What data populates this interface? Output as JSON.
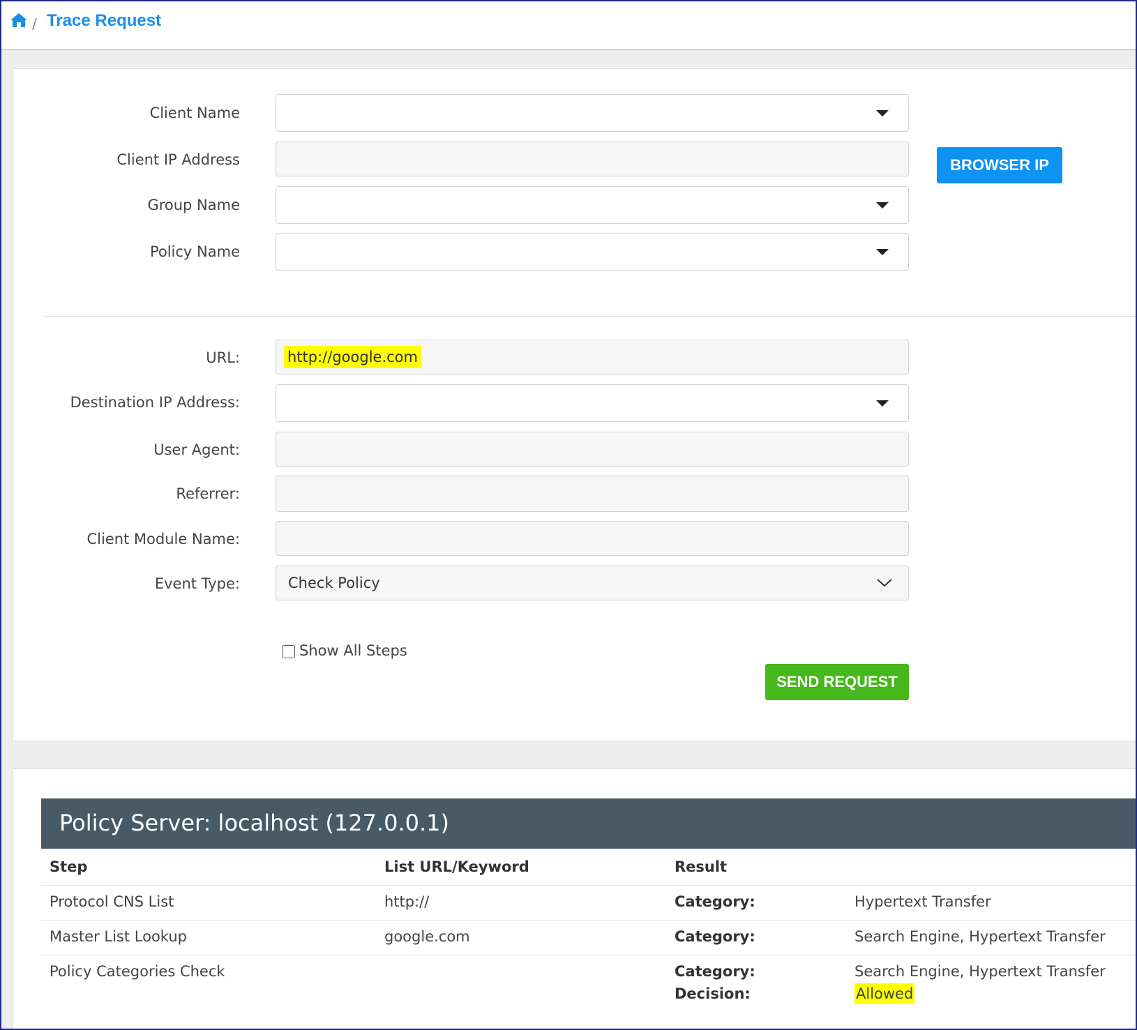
{
  "breadcrumb": {
    "home_icon": "home-icon",
    "separator": "/",
    "title": "Trace Request"
  },
  "form": {
    "client_name_label": "Client Name",
    "client_ip_label": "Client IP Address",
    "group_name_label": "Group Name",
    "policy_name_label": "Policy Name",
    "browser_ip_button": "BROWSER IP",
    "url_label": "URL:",
    "url_value": "http://google.com",
    "dest_ip_label": "Destination IP Address:",
    "user_agent_label": "User Agent:",
    "referrer_label": "Referrer:",
    "client_module_label": "Client Module Name:",
    "event_type_label": "Event Type:",
    "event_type_value": "Check Policy",
    "show_all_steps_label": "Show All Steps",
    "send_request_button": "SEND REQUEST"
  },
  "results": {
    "server_title": "Policy Server: localhost (127.0.0.1)",
    "headers": {
      "step": "Step",
      "list": "List URL/Keyword",
      "result": "Result"
    },
    "rows": [
      {
        "step": "Protocol CNS List",
        "list": "http://",
        "key": "Category:",
        "value": "Hypertext Transfer"
      },
      {
        "step": "Master List Lookup",
        "list": "google.com",
        "key": "Category:",
        "value": "Search Engine, Hypertext Transfer"
      },
      {
        "step": "Policy Categories Check",
        "list": "",
        "key": "Category:",
        "value": "Search Engine, Hypertext Transfer",
        "key2": "Decision:",
        "value2": "Allowed"
      }
    ]
  },
  "colors": {
    "accent_blue": "#0d93f3",
    "send_green": "#47b81c",
    "header_slate": "#475a66",
    "highlight": "#ffff00"
  }
}
